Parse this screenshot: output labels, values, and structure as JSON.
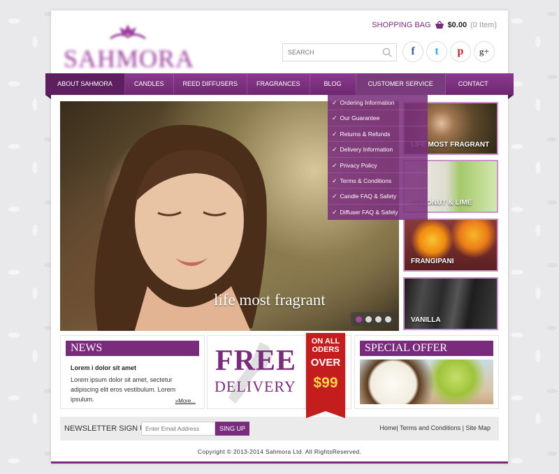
{
  "brand": {
    "logo_text": "SAHMORA"
  },
  "header": {
    "bag_label": "SHOPPING BAG",
    "bag_price": "$0.00",
    "bag_items": "(0 Item)",
    "search_placeholder": "SEARCH",
    "social": [
      {
        "icon": "facebook-icon",
        "glyph": "f",
        "color": "#3b5998"
      },
      {
        "icon": "twitter-icon",
        "glyph": "t",
        "color": "#29a9e1"
      },
      {
        "icon": "pinterest-icon",
        "glyph": "p",
        "color": "#cb2027"
      },
      {
        "icon": "googleplus-icon",
        "glyph": "g+",
        "color": "#555555"
      }
    ]
  },
  "nav": {
    "items": [
      {
        "label": "ABOUT SAHMORA"
      },
      {
        "label": "CANDLES"
      },
      {
        "label": "REED DIFFUSERS"
      },
      {
        "label": "FRAGRANCES"
      },
      {
        "label": "BLOG"
      },
      {
        "label": "CUSTOMER SERVICE"
      },
      {
        "label": "CONTACT"
      }
    ],
    "dropdown": [
      {
        "label": "Ordering Information"
      },
      {
        "label": "Our Guarantee"
      },
      {
        "label": "Returns & Refunds"
      },
      {
        "label": "Delivery Information"
      },
      {
        "label": "Privacy Policy"
      },
      {
        "label": "Terms & Conditions"
      },
      {
        "label": "Candle FAQ & Safety"
      },
      {
        "label": "Diffuser FAQ & Safety"
      }
    ]
  },
  "hero": {
    "caption": "life most fragrant",
    "slides_total": 4,
    "active_slide": 1
  },
  "thumbs": [
    {
      "label": "LIFE MOST FRAGRANT"
    },
    {
      "label": "COCONUT & LIME"
    },
    {
      "label": "FRANGIPANI"
    },
    {
      "label": "VANILLA"
    }
  ],
  "news": {
    "header": "NEWS",
    "title": "Lorem i dolor sit amet",
    "body": "Lorem ipsum dolor sit amet, sectetur adipiscing elit eros vestibulum. Lorem ipsulum.",
    "more": "»More..."
  },
  "delivery": {
    "free": "FREE",
    "delivery": "DELIVERY",
    "ribbon_line1": "ON ALL ODERS",
    "ribbon_line2": "OVER",
    "ribbon_price": "$99"
  },
  "offer": {
    "header": "SPECIAL OFFER"
  },
  "newsletter": {
    "label": "NEWSLETTER SIGN UP",
    "input_placeholder": "Enter Email Address",
    "button": "SING UP"
  },
  "footer": {
    "links": [
      "Home",
      "Terms and Conditions",
      "Site Map"
    ],
    "copyright": "Copyright © 2013-2014 Sahmora Ltd. All RightsReserved."
  },
  "colors": {
    "brand": "#7a2c7c",
    "ribbon": "#c41d1d",
    "price": "#ffd64a"
  }
}
